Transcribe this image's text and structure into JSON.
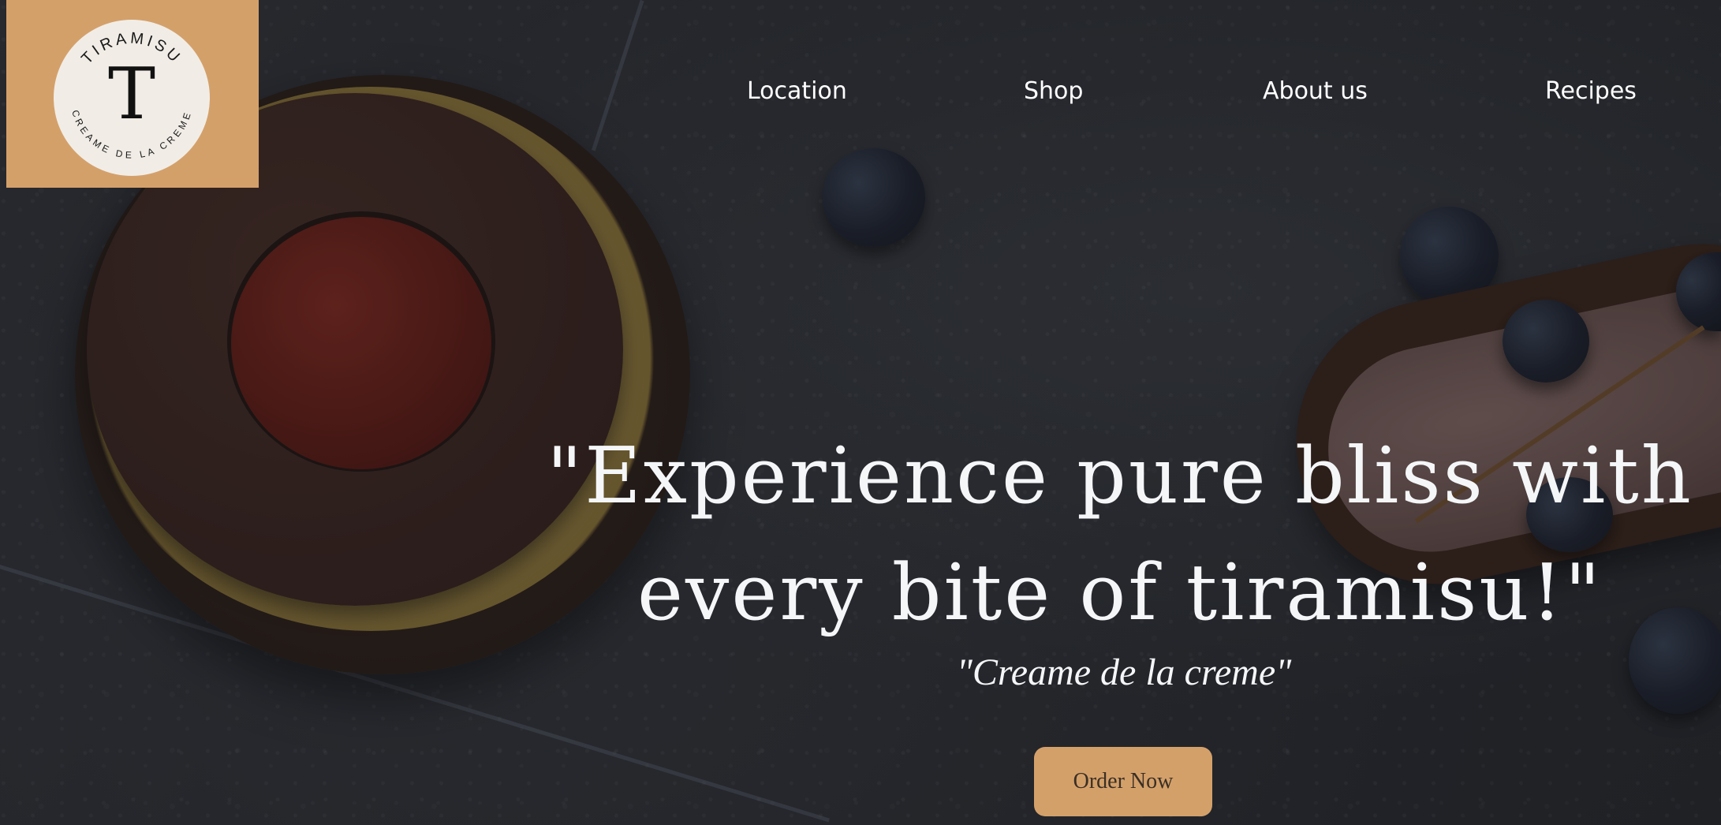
{
  "logo": {
    "letter": "T",
    "top_text": "TIRAMISU",
    "bottom_text": "CREAME DE LA CREME",
    "background_color": "#d4a06a"
  },
  "nav": {
    "items": [
      {
        "label": "Location"
      },
      {
        "label": "Shop"
      },
      {
        "label": "About us"
      },
      {
        "label": "Recipes"
      }
    ]
  },
  "hero": {
    "headline_line1": "\"Experience pure bliss with",
    "headline_line2": "every bite of tiramisu!\"",
    "tagline": "\"Creame de la creme\"",
    "cta_label": "Order Now",
    "accent_color": "#d4a06a"
  }
}
